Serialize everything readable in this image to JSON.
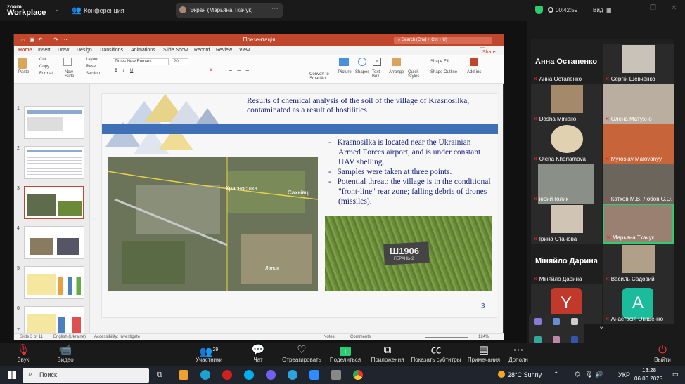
{
  "zoom": {
    "logo_top": "zoom",
    "logo_bottom": "Workplace",
    "conference": "Конференция",
    "screen_share": "Экран (Марьяна Ткачук)",
    "timer": "00:42:59",
    "view": "Вид"
  },
  "ppt": {
    "title": "Презентація",
    "search": "Search (Cmd + Ctrl + U)",
    "tabs": [
      "Home",
      "Insert",
      "Draw",
      "Design",
      "Transitions",
      "Animations",
      "Slide Show",
      "Record",
      "Review",
      "View"
    ],
    "share": "Share",
    "font": "Times New Roman",
    "font_size": "20",
    "ribbon": {
      "paste": "Paste",
      "cut": "Cut",
      "copy": "Copy",
      "format": "Format",
      "new_slide": "New Slide",
      "layout": "Layout",
      "reset": "Reset",
      "section": "Section",
      "picture": "Picture",
      "shapes": "Shapes",
      "text_box": "Text Box",
      "arrange": "Arrange",
      "quick_styles": "Quick Styles",
      "shape_fill": "Shape Fill",
      "shape_outline": "Shape Outline",
      "addins": "Add-ins",
      "convert": "Convert to SmartArt"
    },
    "thumb_numbers": [
      "1",
      "2",
      "3",
      "4",
      "5",
      "6",
      "7"
    ],
    "slide": {
      "title": "Results of chemical analysis of the soil of the village of Krasnosilka, contaminated as a result of hostilities",
      "bullets": [
        "Krasnosilka is located near the Ukrainian Armed Forces airport, and is under constant UAV shelling.",
        "Samples were taken at three points.",
        "Potential threat: the village is in the conditional \"front-line\" rear zone; falling debris of drones (missiles)."
      ],
      "map_labels": {
        "a": "Красносілка",
        "b": "Сахнівці",
        "c": "Ланок"
      },
      "debris_text_1": "Ш1906",
      "debris_text_2": "ГЕРАНЬ-2",
      "page_number": "3"
    },
    "status": {
      "slide": "Slide 3 of 11",
      "lang": "English (Ukraine)",
      "access": "Accessibility: Investigate",
      "notes": "Notes",
      "comments": "Comments",
      "zoom": "124%"
    }
  },
  "gallery": {
    "header": "Анна Остапенко",
    "tiles": [
      {
        "name": "Анна Остапенко"
      },
      {
        "name": "Сергій Шевченко"
      },
      {
        "name": "Dasha Miniailo"
      },
      {
        "name": "Олена Матухно"
      },
      {
        "name": "Olena Kharlamova"
      },
      {
        "name": "Myroslav Malovanyy"
      },
      {
        "name": "юрий голик"
      },
      {
        "name": "Катков М.В. Лобов С.О."
      },
      {
        "name": "Ірина Станова"
      },
      {
        "name": "Марьяна Ткачук"
      },
      {
        "name": "Міняйло Дарина"
      },
      {
        "name": "Василь Садовий"
      },
      {
        "name": ""
      },
      {
        "name": "Анастасія Оніщенко"
      }
    ],
    "header2": "Міняйло Дарина",
    "avatar_y": "Y",
    "avatar_a": "A"
  },
  "toolbar": {
    "items": [
      "Звук",
      "Видео",
      "Участники",
      "Чат",
      "Отреагировать",
      "Поделиться",
      "Приложения",
      "Показать субтитры",
      "Примечания",
      "Дополн",
      "Выйти"
    ],
    "participants_count": "29"
  },
  "taskbar": {
    "search": "Поиск",
    "weather": "28°C Sunny",
    "lang": "УКР",
    "time": "13:28",
    "date": "06.06.2025"
  }
}
